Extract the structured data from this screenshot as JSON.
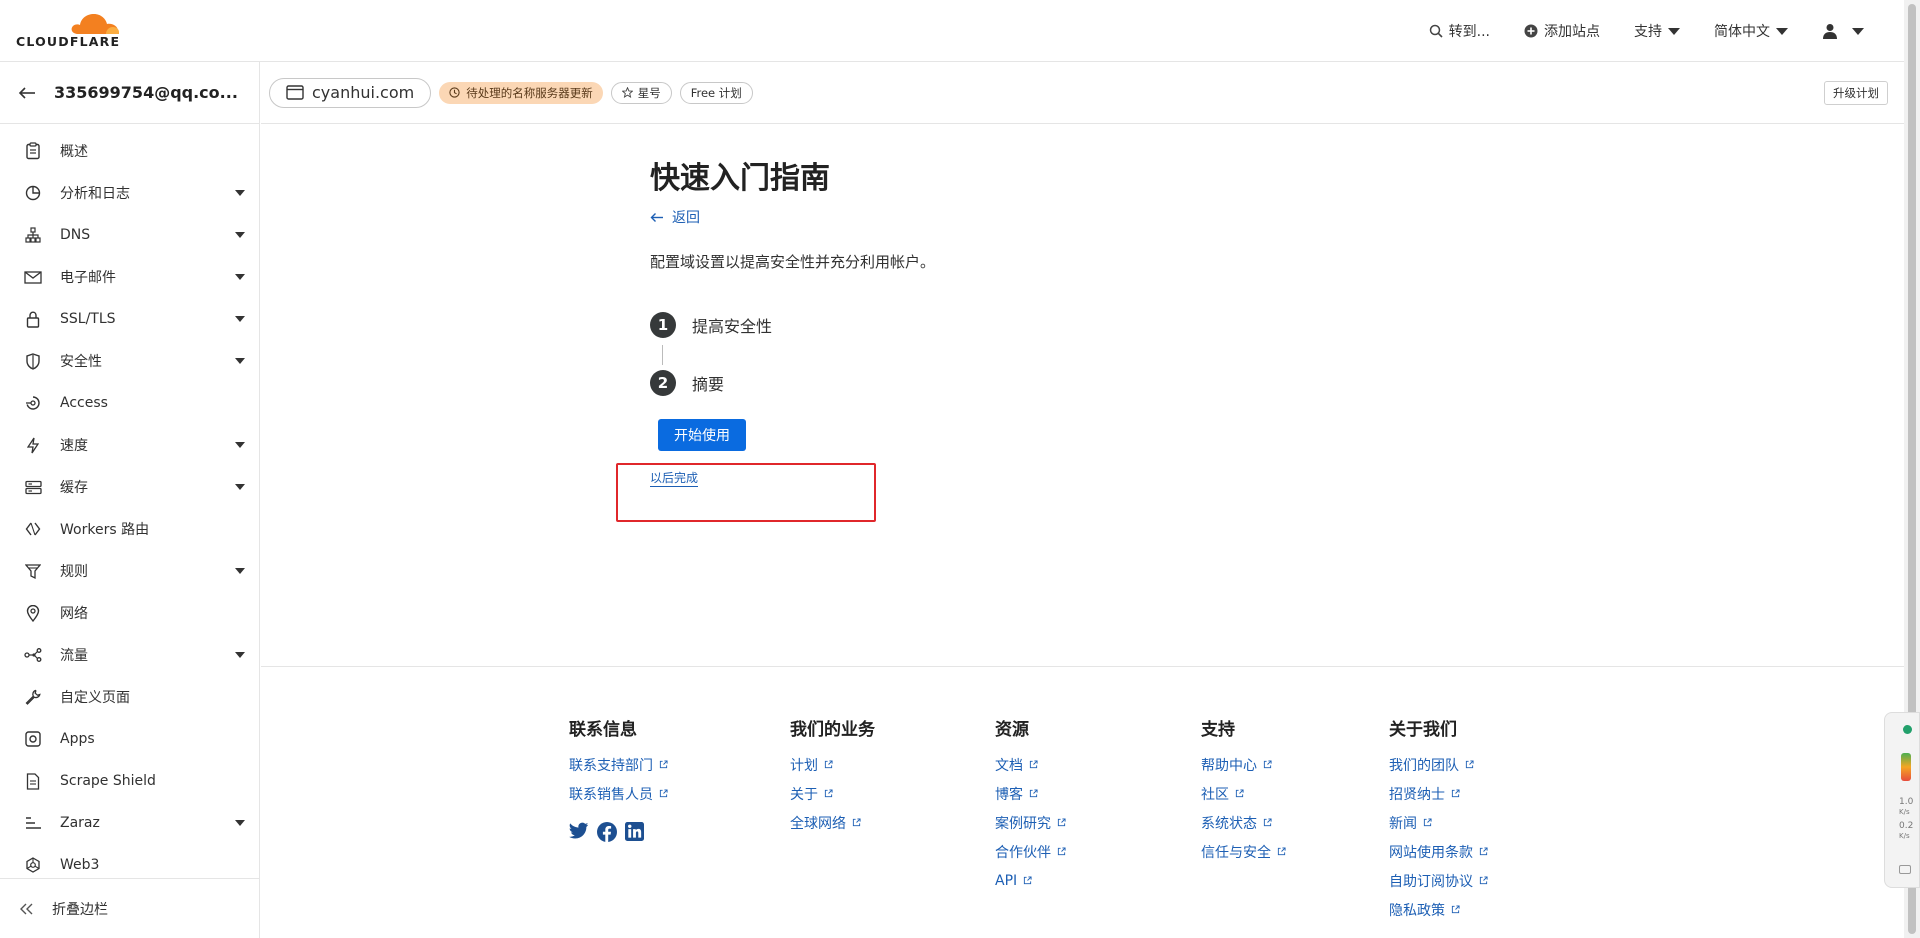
{
  "brand": {
    "name": "CLOUDFLARE",
    "accent": "#f38020"
  },
  "topnav": {
    "search": "转到...",
    "add_site": "添加站点",
    "support": "支持",
    "language": "简体中文"
  },
  "account": {
    "email": "335699754@qq.co..."
  },
  "domainbar": {
    "domain": "cyanhui.com",
    "status_badge": "待处理的名称服务器更新",
    "star": "星号",
    "plan": "Free 计划",
    "upgrade": "升级计划"
  },
  "sidebar": {
    "items": [
      {
        "label": "概述",
        "icon": "clipboard-icon",
        "dropdown": false
      },
      {
        "label": "分析和日志",
        "icon": "chart-icon",
        "dropdown": true
      },
      {
        "label": "DNS",
        "icon": "network-icon",
        "dropdown": true
      },
      {
        "label": "电子邮件",
        "icon": "mail-icon",
        "dropdown": true
      },
      {
        "label": "SSL/TLS",
        "icon": "lock-icon",
        "dropdown": true
      },
      {
        "label": "安全性",
        "icon": "shield-icon",
        "dropdown": true
      },
      {
        "label": "Access",
        "icon": "access-icon",
        "dropdown": false
      },
      {
        "label": "速度",
        "icon": "bolt-icon",
        "dropdown": true
      },
      {
        "label": "缓存",
        "icon": "cache-icon",
        "dropdown": true
      },
      {
        "label": "Workers 路由",
        "icon": "workers-icon",
        "dropdown": false
      },
      {
        "label": "规则",
        "icon": "rules-icon",
        "dropdown": true
      },
      {
        "label": "网络",
        "icon": "location-icon",
        "dropdown": false
      },
      {
        "label": "流量",
        "icon": "traffic-icon",
        "dropdown": true
      },
      {
        "label": "自定义页面",
        "icon": "wrench-icon",
        "dropdown": false
      },
      {
        "label": "Apps",
        "icon": "apps-icon",
        "dropdown": false
      },
      {
        "label": "Scrape Shield",
        "icon": "document-icon",
        "dropdown": false
      },
      {
        "label": "Zaraz",
        "icon": "zaraz-icon",
        "dropdown": true
      },
      {
        "label": "Web3",
        "icon": "web3-icon",
        "dropdown": false
      }
    ],
    "collapse": "折叠边栏"
  },
  "guide": {
    "title": "快速入门指南",
    "back": "返回",
    "description": "配置域设置以提高安全性并充分利用帐户。",
    "steps": [
      {
        "num": "1",
        "label": "提高安全性"
      },
      {
        "num": "2",
        "label": "摘要"
      }
    ],
    "start_button": "开始使用",
    "later_link": "以后完成"
  },
  "footer": {
    "columns": [
      {
        "title": "联系信息",
        "links": [
          "联系支持部门",
          "联系销售人员"
        ]
      },
      {
        "title": "我们的业务",
        "links": [
          "计划",
          "关于",
          "全球网络"
        ]
      },
      {
        "title": "资源",
        "links": [
          "文档",
          "博客",
          "案例研究",
          "合作伙伴",
          "API"
        ]
      },
      {
        "title": "支持",
        "links": [
          "帮助中心",
          "社区",
          "系统状态",
          "信任与安全"
        ]
      },
      {
        "title": "关于我们",
        "links": [
          "我们的团队",
          "招贤纳士",
          "新闻",
          "网站使用条款",
          "自助订阅协议",
          "隐私政策"
        ]
      }
    ],
    "social": [
      "twitter-icon",
      "facebook-icon",
      "linkedin-icon"
    ]
  },
  "widget": {
    "up": "1.0",
    "up_unit": "K/s",
    "down": "0.2",
    "down_unit": "K/s"
  }
}
